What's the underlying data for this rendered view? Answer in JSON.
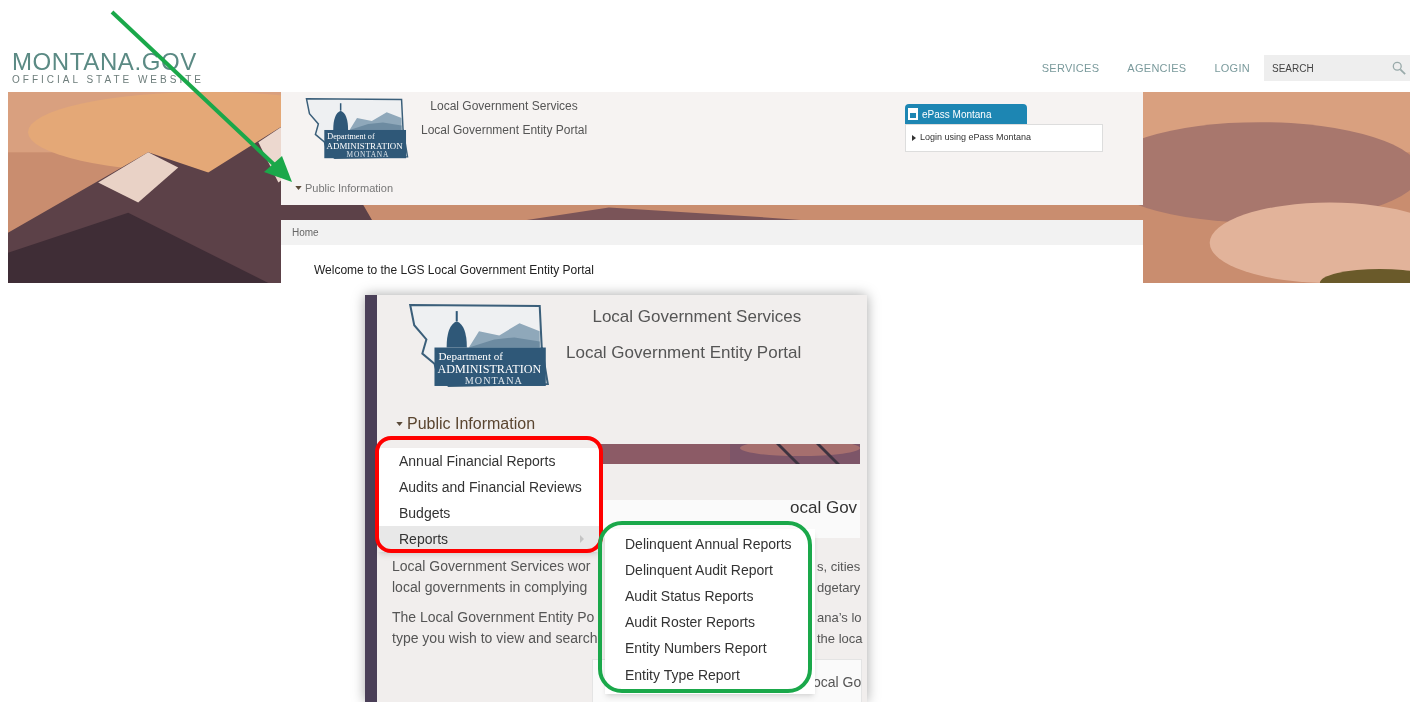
{
  "top_screenshot": {
    "site_logo": {
      "title": "MONTANA.GOV",
      "tagline": "OFFICIAL STATE WEBSITE"
    },
    "nav": [
      {
        "label": "SERVICES"
      },
      {
        "label": "AGENCIES"
      },
      {
        "label": "LOGIN"
      }
    ],
    "search": {
      "placeholder": "SEARCH"
    },
    "agency_logo": {
      "line1": "Department of",
      "line2": "ADMINISTRATION",
      "line3": "MONTANA"
    },
    "titles": [
      "Local Government Services",
      "Local Government Entity Portal"
    ],
    "epass": {
      "tab": "ePass Montana",
      "link": "Login using ePass Montana"
    },
    "menu_label": "Public Information",
    "breadcrumb": "Home",
    "welcome": "Welcome to the LGS Local Government Entity Portal"
  },
  "bottom_screenshot": {
    "agency_logo": {
      "line1": "Department of",
      "line2": "ADMINISTRATION",
      "line3": "MONTANA"
    },
    "titles": [
      "Local Government Services",
      "Local Government Entity Portal"
    ],
    "menu_label": "Public Information",
    "menu_items": [
      {
        "label": "Annual Financial Reports",
        "selected": false,
        "has_submenu": false
      },
      {
        "label": "Audits and Financial Reviews",
        "selected": false,
        "has_submenu": false
      },
      {
        "label": "Budgets",
        "selected": false,
        "has_submenu": false
      },
      {
        "label": "Reports",
        "selected": true,
        "has_submenu": true
      }
    ],
    "submenu_items": [
      "Delinquent Annual Reports",
      "Delinquent Audit Report",
      "Audit Status Reports",
      "Audit Roster Reports",
      "Entity Numbers Report",
      "Entity Type Report"
    ],
    "heading_fragment": "ocal Gov",
    "text_left": [
      "Local Government Services wor",
      "local governments in complying",
      "The Local Government Entity Po",
      "type you wish to view and search"
    ],
    "text_right": [
      "s, cities",
      "dgetary",
      "ana’s lo",
      "the loca"
    ],
    "card_fragment": "ocal Go"
  }
}
